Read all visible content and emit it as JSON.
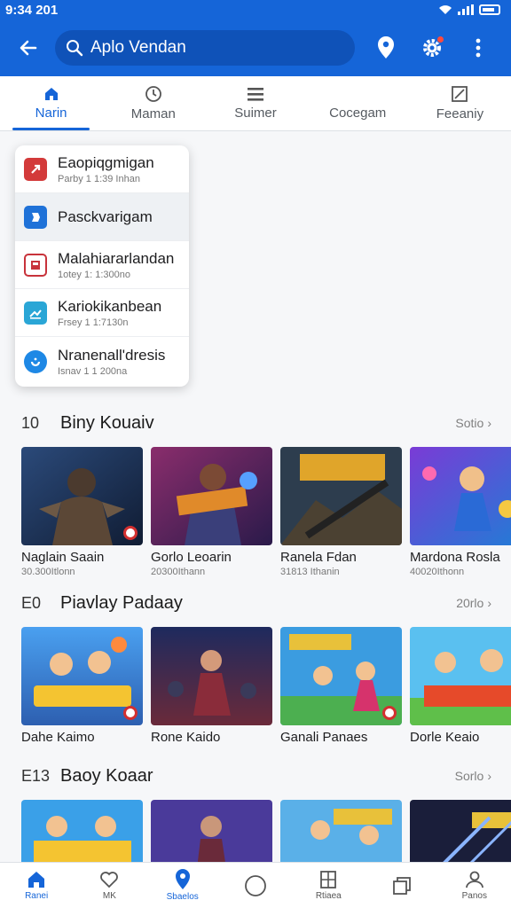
{
  "status": {
    "time": "9:34 201"
  },
  "search": {
    "value": "Aplo Vendan"
  },
  "tabs": [
    {
      "label": "Narin",
      "icon": "home-icon"
    },
    {
      "label": "Maman",
      "icon": "clock-icon"
    },
    {
      "label": "Suimer",
      "icon": "list-icon"
    },
    {
      "label": "Cocegam",
      "icon": "grid-icon"
    },
    {
      "label": "Feeaniy",
      "icon": "edit-icon"
    }
  ],
  "dropdown": [
    {
      "title": "Eaopiqgmigan",
      "sub": "Parby 1 1:39 Inhan",
      "color": "#d33a3a"
    },
    {
      "title": "Pasckvarigam",
      "sub": "",
      "color": "#1f72d8"
    },
    {
      "title": "Malahiararlandan",
      "sub": "1otey 1: 1:300no",
      "color": "#c8333b"
    },
    {
      "title": "Kariokikanbean",
      "sub": "Frsey 1 1:7130n",
      "color": "#2aa6d6"
    },
    {
      "title": "Nranenall'dresis",
      "sub": "Isnav 1 1 200na",
      "color": "#1e88e5"
    }
  ],
  "sections": [
    {
      "num": "10",
      "title": "Biny Kouaiv",
      "more": "Sotio",
      "cards": [
        {
          "title": "Naglain Saain",
          "sub": "30.300Itlonn"
        },
        {
          "title": "Gorlo Leoarin",
          "sub": "20300Ithann"
        },
        {
          "title": "Ranela Fdan",
          "sub": "31813 Ithanin"
        },
        {
          "title": "Mardona Rosla",
          "sub": "40020Ithonn"
        }
      ]
    },
    {
      "num": "E0",
      "title": "Piavlay Padaay",
      "more": "20rlo",
      "cards": [
        {
          "title": "Dahe Kaimo",
          "sub": ""
        },
        {
          "title": "Rone Kaido",
          "sub": ""
        },
        {
          "title": "Ganali Panaes",
          "sub": ""
        },
        {
          "title": "Dorle Keaio",
          "sub": ""
        }
      ]
    },
    {
      "num": "E13",
      "title": "Baoy Koaar",
      "more": "Sorlo",
      "cards": [
        {
          "title": "",
          "sub": ""
        },
        {
          "title": "",
          "sub": ""
        },
        {
          "title": "",
          "sub": ""
        },
        {
          "title": "",
          "sub": ""
        }
      ]
    }
  ],
  "bottom_nav": [
    {
      "label": "Ranei",
      "icon": "home-icon"
    },
    {
      "label": "MK",
      "icon": "heart-icon"
    },
    {
      "label": "Sbaelos",
      "icon": "location-icon"
    },
    {
      "label": "",
      "icon": "circle-icon"
    },
    {
      "label": "Rtiaea",
      "icon": "book-icon"
    },
    {
      "label": "",
      "icon": "copy-icon"
    },
    {
      "label": "Panos",
      "icon": "profile-icon"
    }
  ],
  "colors": {
    "primary": "#1565d8",
    "search_bg": "#0f52b8",
    "accent_red": "#d32f2f"
  }
}
